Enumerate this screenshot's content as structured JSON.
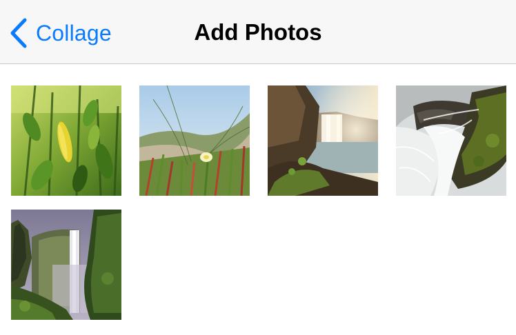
{
  "navbar": {
    "back_label": "Collage",
    "title": "Add Photos"
  },
  "icons": {
    "back": "chevron-left-icon"
  },
  "colors": {
    "accent": "#0a7aff",
    "navbar_bg": "#f7f7f7",
    "separator": "#c8c7cc"
  },
  "photos": [
    {
      "subject": "leaves"
    },
    {
      "subject": "flower"
    },
    {
      "subject": "waterfall"
    },
    {
      "subject": "stream"
    },
    {
      "subject": "falls"
    }
  ]
}
